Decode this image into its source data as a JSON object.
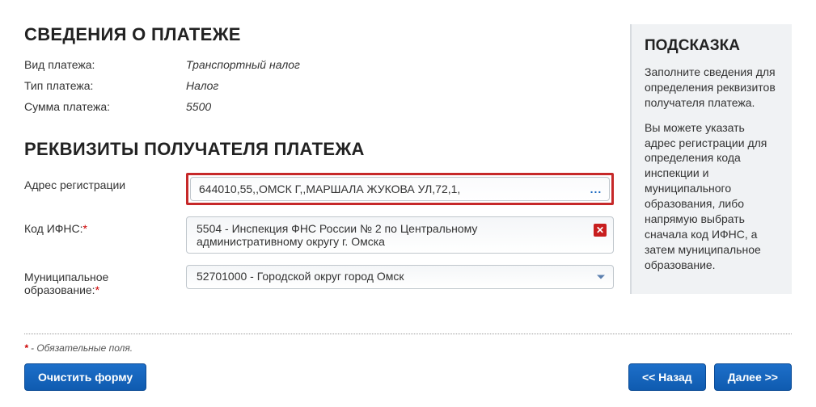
{
  "section_payment": {
    "title": "СВЕДЕНИЯ О ПЛАТЕЖЕ",
    "rows": [
      {
        "label": "Вид платежа:",
        "value": "Транспортный налог"
      },
      {
        "label": "Тип платежа:",
        "value": "Налог"
      },
      {
        "label": "Сумма платежа:",
        "value": "5500"
      }
    ]
  },
  "section_recipient": {
    "title": "РЕКВИЗИТЫ ПОЛУЧАТЕЛЯ ПЛАТЕЖА",
    "address": {
      "label": "Адрес регистрации",
      "value": "644010,55,,ОМСК Г,,МАРШАЛА ЖУКОВА УЛ,72,1,",
      "picker_icon": "..."
    },
    "ifns": {
      "label": "Код ИФНС:",
      "required_mark": "*",
      "value": "5504 - Инспекция ФНС России № 2 по Центральному административному округу г. Омска",
      "clear_icon": "✕"
    },
    "mun": {
      "label": "Муниципальное образование:",
      "required_mark": "*",
      "value": "52701000 - Городской округ город Омск"
    }
  },
  "hint": {
    "title": "ПОДСКАЗКА",
    "p1": "Заполните сведения для определения реквизитов получателя платежа.",
    "p2": "Вы можете указать адрес регистрации для определения кода инспекции и муниципального образования, либо напрямую выбрать сначала код ИФНС, а затем муниципальное образование."
  },
  "required_note": {
    "mark": "*",
    "text": " - Обязательные поля."
  },
  "buttons": {
    "clear": "Очистить форму",
    "back": "<< Назад",
    "next": "Далее >>"
  }
}
